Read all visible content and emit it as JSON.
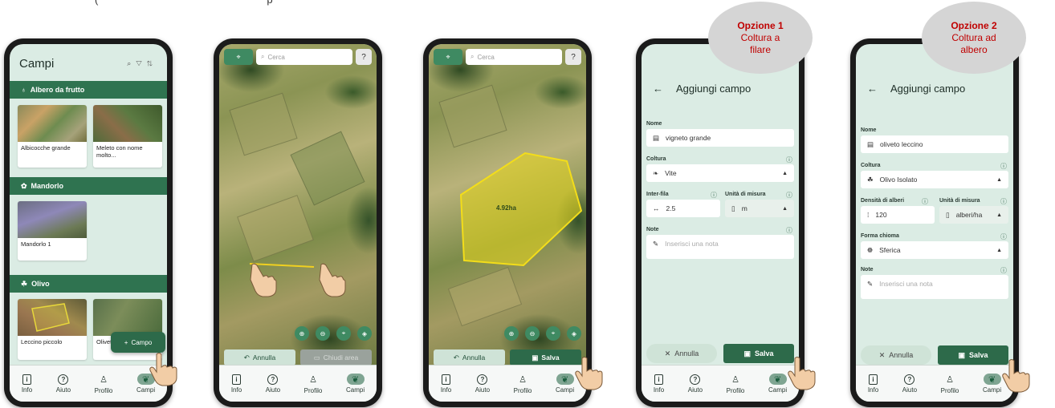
{
  "caption": "(",
  "caption_tail": "p",
  "nav": {
    "info": "Info",
    "aiuto": "Aiuto",
    "profilo": "Profilo",
    "campi": "Campi"
  },
  "phone1": {
    "title": "Campi",
    "sections": [
      {
        "label": "Albero da frutto",
        "cards": [
          "Albicocche grande",
          "Meleto con nome molto..."
        ]
      },
      {
        "label": "Mandorlo",
        "cards": [
          "Mandorlo 1"
        ]
      },
      {
        "label": "Olivo",
        "cards": [
          "Leccino piccolo",
          "Oliveto i"
        ]
      }
    ],
    "fab_label": "Campo"
  },
  "phone2": {
    "search_placeholder": "Cerca",
    "help": "?",
    "cancel": "Annulla",
    "close_area": "Chiudi area"
  },
  "phone3": {
    "search_placeholder": "Cerca",
    "help": "?",
    "area_label": "4.92ha",
    "cancel": "Annulla",
    "save": "Salva"
  },
  "phone4": {
    "bubble_line1": "Opzione 1",
    "bubble_line2": "Coltura a",
    "bubble_line3": "filare",
    "header": "Aggiungi campo",
    "name_label": "Nome",
    "name_value": "vigneto grande",
    "crop_label": "Coltura",
    "crop_value": "Vite",
    "interfila_label": "Inter-fila",
    "interfila_value": "2.5",
    "unit_label": "Unità di misura",
    "unit_value": "m",
    "note_label": "Note",
    "note_placeholder": "Inserisci una nota",
    "cancel": "Annulla",
    "save": "Salva"
  },
  "phone5": {
    "bubble_line1": "Opzione 2",
    "bubble_line2": "Coltura ad",
    "bubble_line3": "albero",
    "header": "Aggiungi campo",
    "name_label": "Nome",
    "name_value": "oliveto leccino",
    "crop_label": "Coltura",
    "crop_value": "Olivo Isolato",
    "density_label": "Densità di alberi",
    "density_value": "120",
    "unit_label": "Unità di misura",
    "unit_value": "alberi/ha",
    "canopy_label": "Forma chioma",
    "canopy_value": "Sferica",
    "note_label": "Note",
    "note_placeholder": "Inserisci una nota",
    "cancel": "Annulla",
    "save": "Salva"
  }
}
